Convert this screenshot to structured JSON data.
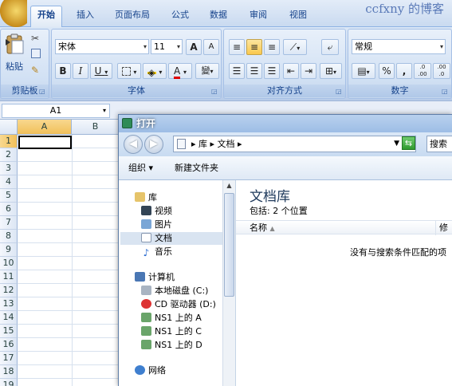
{
  "ribbon": {
    "brand": "ccfxny 的博客",
    "tabs": [
      "开始",
      "插入",
      "页面布局",
      "公式",
      "数据",
      "审阅",
      "视图"
    ],
    "clipboard": {
      "paste_label": "粘贴",
      "group_label": "剪贴板"
    },
    "font": {
      "name": "宋体",
      "size": "11",
      "grow": "A",
      "shrink": "A",
      "bold": "B",
      "italic": "I",
      "underline": "U",
      "color_glyph": "A",
      "phonetic": "變",
      "group_label": "字体"
    },
    "alignment": {
      "group_label": "对齐方式"
    },
    "number": {
      "format": "常规",
      "percent": "%",
      "comma": ",",
      "inc_decimal": ".0 .00",
      "dec_decimal": ".00 .0",
      "group_label": "数字"
    }
  },
  "formula_bar": {
    "name_box": "A1"
  },
  "sheet": {
    "columns": [
      "A",
      "B"
    ],
    "rows": [
      "1",
      "2",
      "3",
      "4",
      "5",
      "6",
      "7",
      "8",
      "9",
      "10",
      "11",
      "12",
      "13",
      "14",
      "15",
      "16",
      "17",
      "18",
      "19"
    ]
  },
  "dialog": {
    "title": "打开",
    "address": "▸ 库 ▸ 文档 ▸",
    "search_placeholder": "搜索",
    "toolbar": {
      "organize": "组织 ▾",
      "new_folder": "新建文件夹"
    },
    "nav": {
      "libraries": "库",
      "videos": "视频",
      "pictures": "图片",
      "documents": "文档",
      "music": "音乐",
      "computer": "计算机",
      "local_disk": "本地磁盘 (C:)",
      "cd_drive": "CD 驱动器 (D:)",
      "ns1_a": "NS1 上的 A",
      "ns1_c": "NS1 上的 C",
      "ns1_d": "NS1 上的 D",
      "network": "网络"
    },
    "content": {
      "title": "文档库",
      "subtitle": "包括: 2 个位置",
      "col_name": "名称",
      "col_modified": "修",
      "empty_message": "没有与搜索条件匹配的项"
    }
  }
}
